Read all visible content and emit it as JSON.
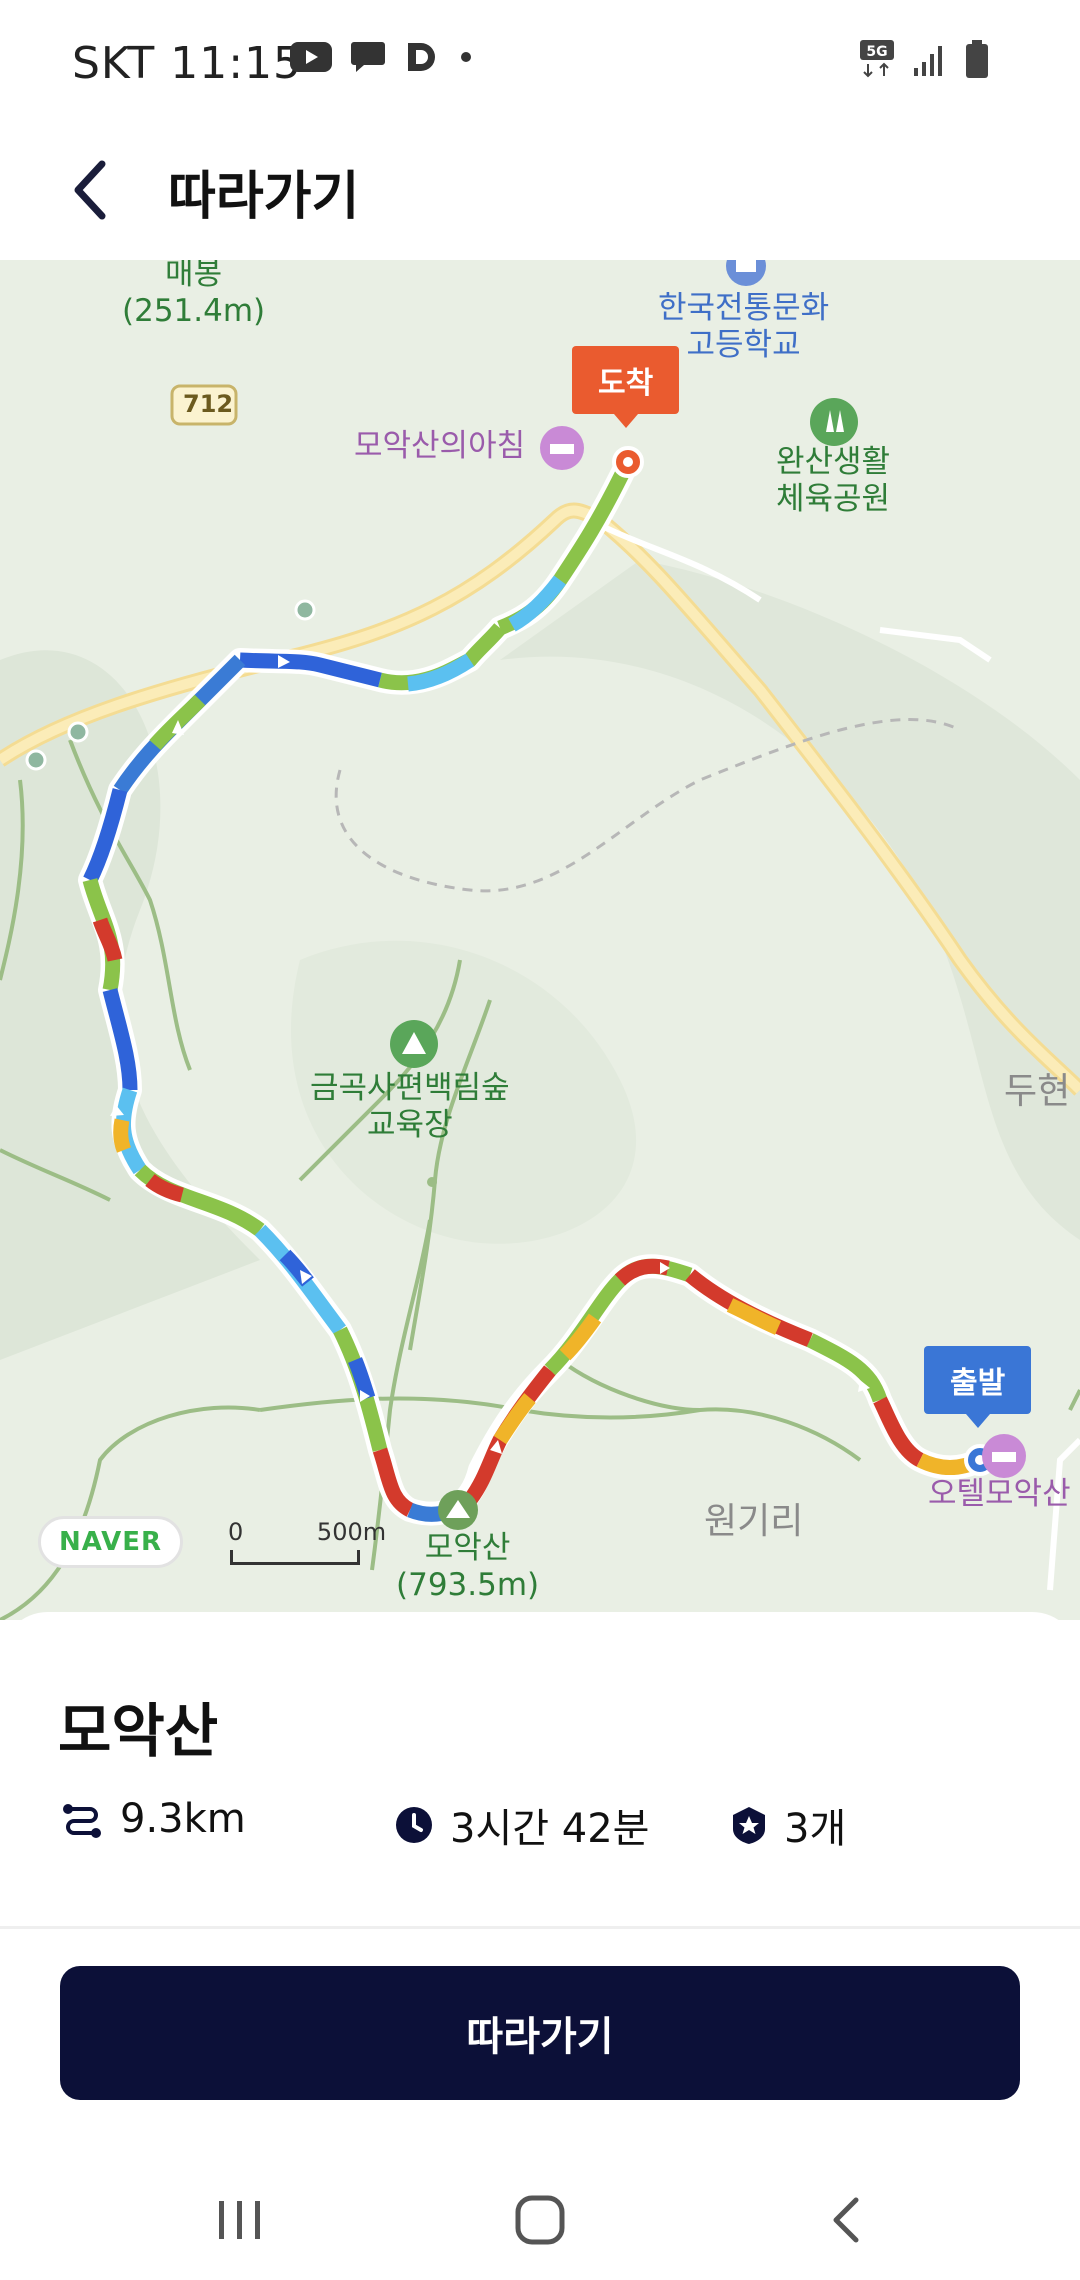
{
  "status_bar": {
    "carrier": "SKT",
    "time": "11:15",
    "network": "5G"
  },
  "header": {
    "title": "따라가기"
  },
  "map": {
    "labels": {
      "peak_maebong_name": "매봉",
      "peak_maebong_height": "(251.4m)",
      "road_number": "712",
      "school_1": "한국전통문화",
      "school_2": "고등학교",
      "motel_north": "모악산의아침",
      "park_1": "완산생활",
      "park_2": "체육공원",
      "camp_1": "금곡사편백림숲",
      "camp_2": "교육장",
      "village_right": "두현",
      "village_wongi": "원기리",
      "peak_moak_name": "모악산",
      "peak_moak_height": "(793.5m)",
      "motel_south": "오텔모악산"
    },
    "end_pin": "도착",
    "start_pin": "출발",
    "naver_logo": "NAVER",
    "scale_zero": "0",
    "scale_distance": "500m"
  },
  "course": {
    "name": "모악산",
    "distance": "9.3km",
    "duration": "3시간 42분",
    "badges": "3개"
  },
  "action": {
    "follow_label": "따라가기"
  },
  "colors": {
    "primary_button": "#0c1038",
    "end_pin": "#ea5b2f",
    "start_pin": "#3a76d6"
  }
}
